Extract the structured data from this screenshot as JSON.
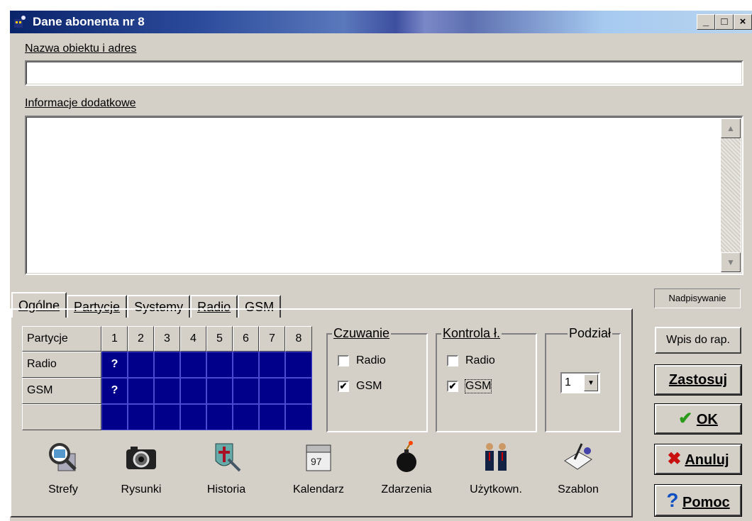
{
  "window": {
    "title": "Dane abonenta nr 8",
    "minimize": "_",
    "maximize": "□",
    "close": "×"
  },
  "fields": {
    "name_label": "Nazwa obiektu i adres",
    "name_value": "",
    "info_label": "Informacje dodatkowe",
    "info_value": ""
  },
  "tabs": [
    {
      "label": "Ogólne",
      "active": true
    },
    {
      "label": "Partycje",
      "active": false
    },
    {
      "label": "Systemy",
      "active": false
    },
    {
      "label": "Radio",
      "active": false
    },
    {
      "label": "GSM",
      "active": false
    }
  ],
  "status": "Nadpisywanie",
  "grid": {
    "corner": "Partycje",
    "columns": [
      "1",
      "2",
      "3",
      "4",
      "5",
      "6",
      "7",
      "8"
    ],
    "rows": [
      {
        "label": "Radio",
        "cells": [
          "?",
          "",
          "",
          "",
          "",
          "",
          "",
          ""
        ]
      },
      {
        "label": "GSM",
        "cells": [
          "?",
          "",
          "",
          "",
          "",
          "",
          "",
          ""
        ]
      },
      {
        "label": "",
        "cells": [
          "",
          "",
          "",
          "",
          "",
          "",
          "",
          ""
        ]
      }
    ]
  },
  "czuwanie": {
    "title": "Czuwanie",
    "radio_label": "Radio",
    "radio_checked": false,
    "gsm_label": "GSM",
    "gsm_checked": true
  },
  "kontrola": {
    "title": "Kontrola ł.",
    "radio_label": "Radio",
    "radio_checked": false,
    "gsm_label": "GSM",
    "gsm_checked": true
  },
  "podzial": {
    "title": "Podział",
    "value": "1"
  },
  "toolbar": [
    {
      "label": "Strefy",
      "icon": "magnifier-icon"
    },
    {
      "label": "Rysunki",
      "icon": "camera-icon"
    },
    {
      "label": "Historia",
      "icon": "shield-icon"
    },
    {
      "label": "Kalendarz",
      "icon": "calendar-icon"
    },
    {
      "label": "Zdarzenia",
      "icon": "bomb-icon"
    },
    {
      "label": "Użytkown.",
      "icon": "users-icon"
    },
    {
      "label": "Szablon",
      "icon": "template-icon"
    }
  ],
  "buttons": {
    "wpis": "Wpis do rap.",
    "zastosuj": "Zastosuj",
    "ok": "OK",
    "anuluj": "Anuluj",
    "pomoc": "Pomoc"
  },
  "colors": {
    "face": "#d4d0c8",
    "grid_blue": "#00008b",
    "ok_green": "#2a9a1a",
    "cancel_red": "#c81010",
    "help_blue": "#1050c0"
  }
}
